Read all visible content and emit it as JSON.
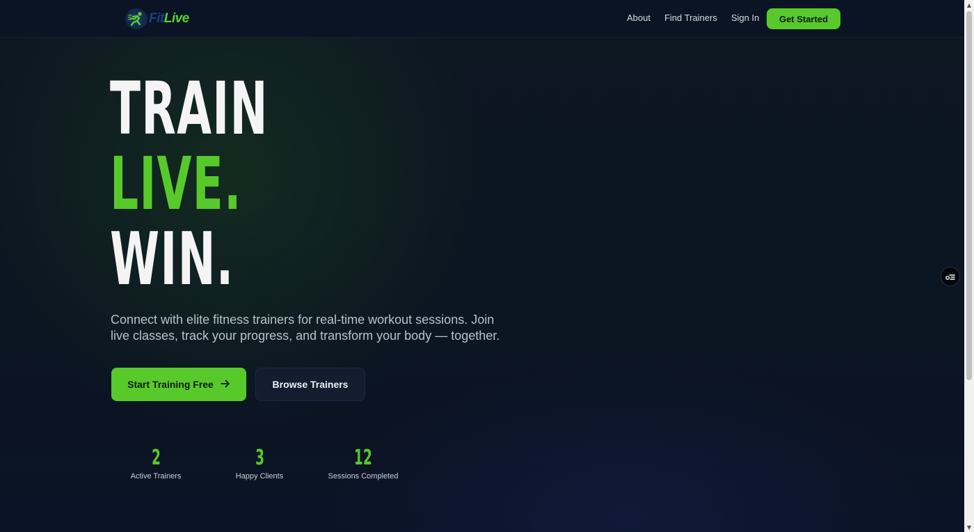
{
  "header": {
    "logo": {
      "part1": "Fit",
      "part2": "Live",
      "icon": "runner-icon"
    },
    "nav": [
      {
        "label": "About"
      },
      {
        "label": "Find Trainers"
      },
      {
        "label": "Sign In"
      }
    ],
    "cta_label": "Get Started"
  },
  "hero": {
    "line1": "TRAIN",
    "line2": "LIVE.",
    "line3": "WIN.",
    "subtitle": "Connect with elite fitness trainers for real-time workout sessions. Join live classes, track your progress, and transform your body — together.",
    "primary_button": {
      "label": "Start Training Free",
      "icon": "arrow-right-icon"
    },
    "secondary_button": {
      "label": "Browse Trainers"
    }
  },
  "stats": [
    {
      "value": "2",
      "label": "Active Trainers"
    },
    {
      "value": "3",
      "label": "Happy Clients"
    },
    {
      "value": "12",
      "label": "Sessions Completed"
    }
  ],
  "floating_button": {
    "icon": "accessibility-menu-icon"
  },
  "colors": {
    "accent": "#58c92a",
    "background": "#0c1423",
    "logo_blue": "#1e3f87"
  }
}
